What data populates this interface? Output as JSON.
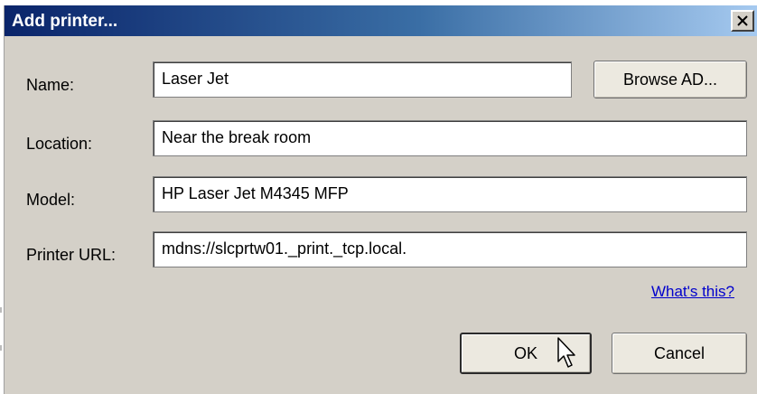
{
  "dialog": {
    "title": "Add printer...",
    "close_glyph": "×"
  },
  "form": {
    "name_label": "Name:",
    "name_value": "Laser Jet",
    "location_label": "Location:",
    "location_value": "Near the break room",
    "model_label": "Model:",
    "model_value": "HP Laser Jet M4345 MFP",
    "url_label": "Printer URL:",
    "url_value": "mdns://slcprtw01._print._tcp.local."
  },
  "buttons": {
    "browse_label": "Browse AD...",
    "ok_label": "OK",
    "cancel_label": "Cancel"
  },
  "help_link": "What's this?",
  "colors": {
    "title_start": "#0a246a",
    "title_end": "#a6caf0",
    "window_bg": "#d4d0c8",
    "link": "#0000cc"
  },
  "icons": {
    "close": "close-icon",
    "pointer": "mouse-pointer-icon"
  }
}
